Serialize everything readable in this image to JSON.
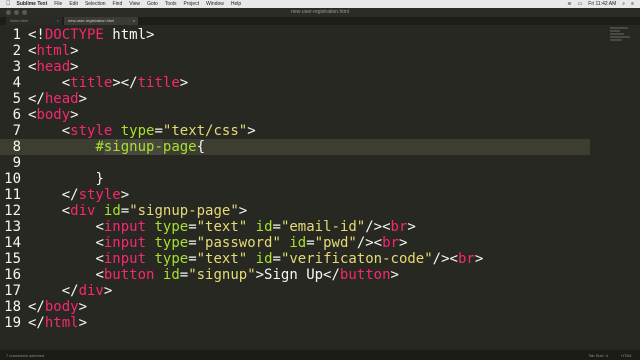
{
  "menubar": {
    "apple_icon": "",
    "app_name": "Sublime Text",
    "items": [
      "File",
      "Edit",
      "Selection",
      "Find",
      "View",
      "Goto",
      "Tools",
      "Project",
      "Window",
      "Help"
    ],
    "clock": "Fri 11:42 AM"
  },
  "window": {
    "title": "new-user-registration.html"
  },
  "tabs": [
    {
      "label": "index.html",
      "active": false
    },
    {
      "label": "new-user-registration.html",
      "active": true
    }
  ],
  "editor": {
    "highlighted_line": 8,
    "lines": [
      "1",
      "2",
      "3",
      "4",
      "5",
      "6",
      "7",
      "8",
      "9",
      "10",
      "11",
      "12",
      "13",
      "14",
      "15",
      "16",
      "17",
      "18",
      "19"
    ]
  },
  "statusbar": {
    "left": "7 characters selected",
    "tab_size": "Tab Size: 4",
    "syntax": "HTML"
  }
}
